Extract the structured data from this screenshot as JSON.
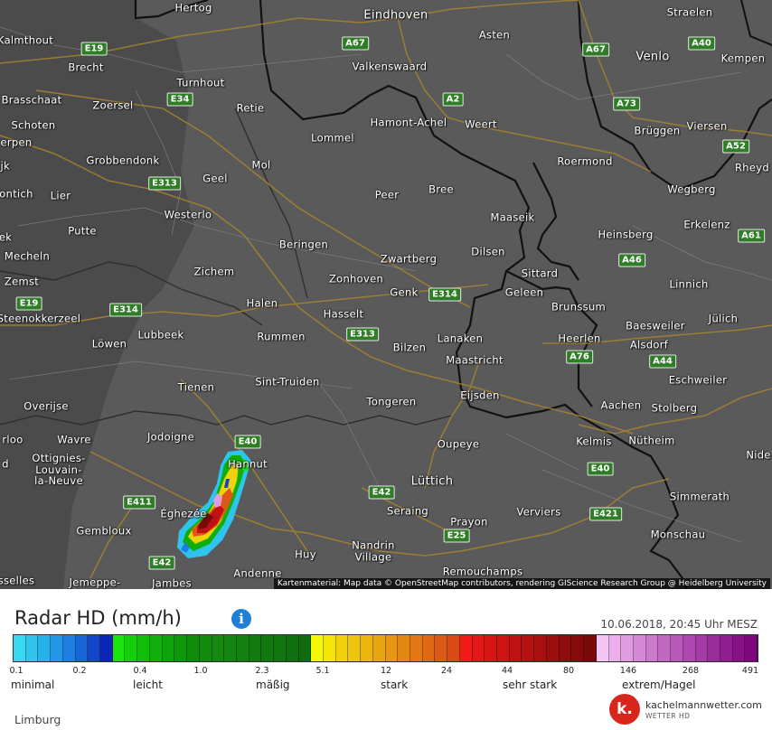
{
  "map": {
    "places": [
      {
        "name": "Hertog",
        "major": false
      },
      {
        "name": "Eindhoven",
        "major": true
      },
      {
        "name": "Kalmthout",
        "major": false
      },
      {
        "name": "Asten",
        "major": false
      },
      {
        "name": "Straelen",
        "major": false
      },
      {
        "name": "Brecht",
        "major": false
      },
      {
        "name": "Venlo",
        "major": true
      },
      {
        "name": "Kempen",
        "major": false
      },
      {
        "name": "Turnhout",
        "major": false
      },
      {
        "name": "Valkenswaard",
        "major": false
      },
      {
        "name": "Brasschaat",
        "major": false
      },
      {
        "name": "Zoersel",
        "major": false
      },
      {
        "name": "Retie",
        "major": false
      },
      {
        "name": "Schoten",
        "major": false
      },
      {
        "name": "Hamont-Achel",
        "major": false
      },
      {
        "name": "Weert",
        "major": false
      },
      {
        "name": "Brüggen",
        "major": false
      },
      {
        "name": "Viersen",
        "major": false
      },
      {
        "name": "erpen",
        "major": false
      },
      {
        "name": "Lommel",
        "major": false
      },
      {
        "name": "Roermond",
        "major": false
      },
      {
        "name": "Grobbendonk",
        "major": false
      },
      {
        "name": "Mol",
        "major": false
      },
      {
        "name": "Rheyd",
        "major": false
      },
      {
        "name": "ijk",
        "major": false
      },
      {
        "name": "Geel",
        "major": false
      },
      {
        "name": "Bree",
        "major": false
      },
      {
        "name": "Wegberg",
        "major": false
      },
      {
        "name": "ontich",
        "major": false
      },
      {
        "name": "Lier",
        "major": false
      },
      {
        "name": "Peer",
        "major": false
      },
      {
        "name": "Westerlo",
        "major": false
      },
      {
        "name": "Maaseik",
        "major": false
      },
      {
        "name": "Erkelenz",
        "major": false
      },
      {
        "name": "Putte",
        "major": false
      },
      {
        "name": "Heinsberg",
        "major": false
      },
      {
        "name": "ek",
        "major": false
      },
      {
        "name": "Beringen",
        "major": false
      },
      {
        "name": "Dilsen",
        "major": false
      },
      {
        "name": "Mecheln",
        "major": false
      },
      {
        "name": "Zwartberg",
        "major": false
      },
      {
        "name": "Sittard",
        "major": false
      },
      {
        "name": "Zichem",
        "major": false
      },
      {
        "name": "Zemst",
        "major": false
      },
      {
        "name": "Zonhoven",
        "major": false
      },
      {
        "name": "Linnich",
        "major": false
      },
      {
        "name": "Genk",
        "major": false
      },
      {
        "name": "Geleen",
        "major": false
      },
      {
        "name": "Halen",
        "major": false
      },
      {
        "name": "Brunssum",
        "major": false
      },
      {
        "name": "Steenokkerzeel",
        "major": false
      },
      {
        "name": "Hasselt",
        "major": false
      },
      {
        "name": "Jülich",
        "major": false
      },
      {
        "name": "Baesweiler",
        "major": false
      },
      {
        "name": "Lubbeek",
        "major": false
      },
      {
        "name": "Rummen",
        "major": false
      },
      {
        "name": "Lanaken",
        "major": false
      },
      {
        "name": "Heerlen",
        "major": false
      },
      {
        "name": "Löwen",
        "major": false
      },
      {
        "name": "Bilzen",
        "major": false
      },
      {
        "name": "Alsdorf",
        "major": false
      },
      {
        "name": "Maastricht",
        "major": false
      },
      {
        "name": "Sint-Truiden",
        "major": false
      },
      {
        "name": "Eschweiler",
        "major": false
      },
      {
        "name": "Tienen",
        "major": false
      },
      {
        "name": "Eijsden",
        "major": false
      },
      {
        "name": "Tongeren",
        "major": false
      },
      {
        "name": "Aachen",
        "major": false
      },
      {
        "name": "Stolberg",
        "major": false
      },
      {
        "name": "Overijse",
        "major": false
      },
      {
        "name": "Jodoigne",
        "major": false
      },
      {
        "name": "rloo",
        "major": false
      },
      {
        "name": "Wavre",
        "major": false
      },
      {
        "name": "Oupeye",
        "major": false
      },
      {
        "name": "Kelmis",
        "major": false
      },
      {
        "name": "Nütheim",
        "major": false
      },
      {
        "name": "Hannut",
        "major": false
      },
      {
        "name": "Nide",
        "major": false
      },
      {
        "name": "d",
        "major": false
      },
      {
        "name": "Ottignies-\nLouvain-\nla-Neuve",
        "major": false
      },
      {
        "name": "Lüttich",
        "major": true
      },
      {
        "name": "Simmerath",
        "major": false
      },
      {
        "name": "Éghezée",
        "major": false
      },
      {
        "name": "Seraing",
        "major": false
      },
      {
        "name": "Verviers",
        "major": false
      },
      {
        "name": "Gembloux",
        "major": false
      },
      {
        "name": "Prayon",
        "major": false
      },
      {
        "name": "Monschau",
        "major": false
      },
      {
        "name": "Nandrin\nVillage",
        "major": false
      },
      {
        "name": "Huy",
        "major": false
      },
      {
        "name": "Remouchamps",
        "major": false
      },
      {
        "name": "Andenne",
        "major": false
      },
      {
        "name": "sselles",
        "major": false
      },
      {
        "name": "Jemeppe-",
        "major": false
      },
      {
        "name": "Jambes",
        "major": false
      }
    ],
    "roads": [
      "E19",
      "A67",
      "A67",
      "A40",
      "E34",
      "A2",
      "A73",
      "E313",
      "A52",
      "A61",
      "E19",
      "A46",
      "E314",
      "E314",
      "E313",
      "A76",
      "A44",
      "E40",
      "E42",
      "E40",
      "E411",
      "E42",
      "E421",
      "E25"
    ],
    "attribution": "Kartenmaterial: Map data © OpenStreetMap contributors, rendering GIScience Research Group @ Heidelberg University"
  },
  "legend": {
    "title": "Radar HD (mm/h)",
    "info_icon": "info-icon",
    "timestamp": "10.06.2018, 20:45 Uhr MESZ",
    "colors": [
      "#38d8f0",
      "#2ec4ee",
      "#27b1ea",
      "#2397e6",
      "#1e7fe0",
      "#1866d6",
      "#1245c8",
      "#0c25b8",
      "#16e60c",
      "#12d10b",
      "#10bd0a",
      "#0fae0a",
      "#0ea30a",
      "#0d970a",
      "#0e8d0b",
      "#118a0d",
      "#148a10",
      "#138512",
      "#13800f",
      "#127a0f",
      "#117a0f",
      "#117510",
      "#107010",
      "#0f6c0f",
      "#f6f608",
      "#f4e40a",
      "#f0d20c",
      "#eec40c",
      "#ecb50e",
      "#e9a50f",
      "#e79610",
      "#e48612",
      "#e27713",
      "#df6814",
      "#dc5915",
      "#d94a16",
      "#f11919",
      "#e41717",
      "#d81515",
      "#cc1414",
      "#c01212",
      "#b41111",
      "#a80f0f",
      "#9c0e0e",
      "#900c0c",
      "#850b0b",
      "#7a0a0a",
      "#f4c4f4",
      "#eaaeea",
      "#e09ce0",
      "#d68ad6",
      "#cc78cc",
      "#c268c2",
      "#b858b8",
      "#ae48ae",
      "#a43aa4",
      "#9a2c9a",
      "#901e90",
      "#861286",
      "#7c087c"
    ],
    "ticks": [
      "0.1",
      "0.2",
      "0.4",
      "1.0",
      "2.3",
      "5.1",
      "12",
      "24",
      "44",
      "80",
      "146",
      "268",
      "491"
    ],
    "categories": [
      "minimal",
      "leicht",
      "mäßig",
      "stark",
      "sehr stark",
      "extrem/Hagel"
    ],
    "region": "Limburg"
  },
  "brand": {
    "logo": "k.",
    "name": "kachelmannwetter.com",
    "sub": "WETTER HD"
  }
}
